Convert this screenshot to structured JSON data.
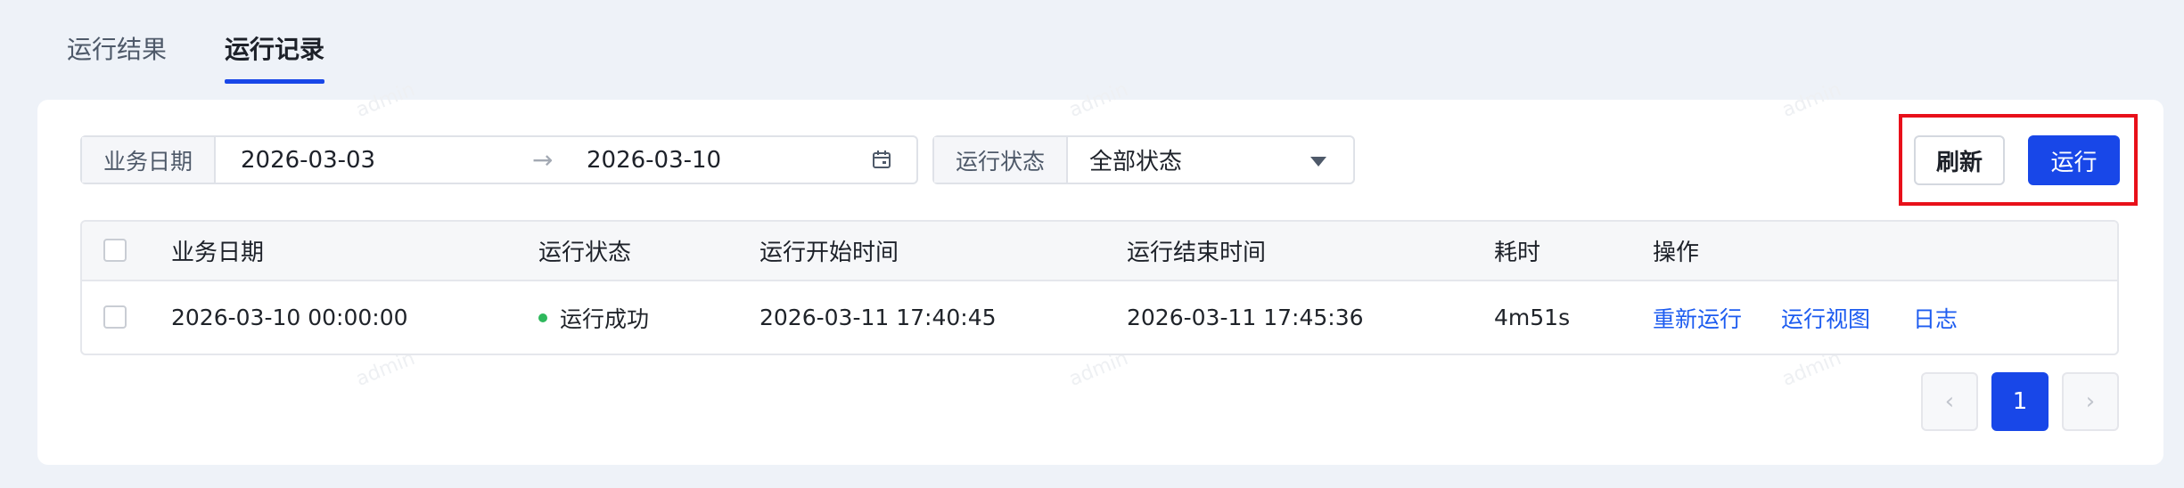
{
  "tabs": [
    {
      "label": "运行结果",
      "active": false
    },
    {
      "label": "运行记录",
      "active": true
    }
  ],
  "watermark": "admin",
  "filters": {
    "business_date_label": "业务日期",
    "date_start": "2026-03-03",
    "date_arrow": "→",
    "date_end": "2026-03-10",
    "status_label": "运行状态",
    "status_value": "全部状态"
  },
  "actions": {
    "refresh_label": "刷新",
    "run_label": "运行"
  },
  "table": {
    "columns": [
      "业务日期",
      "运行状态",
      "运行开始时间",
      "运行结束时间",
      "耗时",
      "操作"
    ],
    "rows": [
      {
        "business_date": "2026-03-10 00:00:00",
        "status": "运行成功",
        "status_color": "#2eb85c",
        "start_time": "2026-03-11 17:40:45",
        "end_time": "2026-03-11 17:45:36",
        "duration": "4m51s",
        "ops": [
          "重新运行",
          "运行视图",
          "日志"
        ]
      }
    ]
  },
  "pagination": {
    "prev": "‹",
    "current_page": "1",
    "next": "›"
  },
  "colors": {
    "primary": "#1847e8",
    "link": "#1d5cf0",
    "highlight": "#e8101a"
  }
}
